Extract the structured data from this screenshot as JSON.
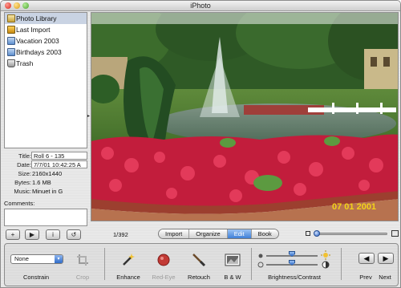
{
  "window": {
    "title": "iPhoto"
  },
  "source_list": {
    "items": [
      {
        "label": "Photo Library",
        "icon": "photo-library-icon",
        "selected": true
      },
      {
        "label": "Last Import",
        "icon": "last-import-icon",
        "selected": false
      },
      {
        "label": "Vacation 2003",
        "icon": "album-icon",
        "selected": false
      },
      {
        "label": "Birthdays 2003",
        "icon": "album-icon",
        "selected": false
      },
      {
        "label": "Trash",
        "icon": "trash-icon",
        "selected": false
      }
    ]
  },
  "info": {
    "title_label": "Title:",
    "title_value": "Roll 6 - 135",
    "date_label": "Date:",
    "date_value": "7/7/01  10:42:25 A",
    "size_label": "Size:",
    "size_value": "2160x1440",
    "bytes_label": "Bytes:",
    "bytes_value": "1.6 MB",
    "music_label": "Music:",
    "music_value": "Minuet in G",
    "comments_label": "Comments:"
  },
  "photo": {
    "date_stamp": "07 01 2001",
    "description_icon": "garden-fountain-photo"
  },
  "toolbar": {
    "add_label": "+",
    "play_label": "▶",
    "info_label": "i",
    "rotate_label": "↺",
    "photo_count": "1/392",
    "modes": [
      "Import",
      "Organize",
      "Edit",
      "Book"
    ],
    "active_mode": "Edit",
    "zoom_level": 0.05
  },
  "edit": {
    "constrain_value": "None",
    "constrain_label": "Constrain",
    "crop_label": "Crop",
    "enhance_label": "Enhance",
    "red_eye_label": "Red-Eye",
    "retouch_label": "Retouch",
    "bw_label": "B & W",
    "brightness_contrast_label": "Brightness/Contrast",
    "brightness_level": 0.5,
    "contrast_level": 0.5,
    "prev_label": "Prev",
    "next_label": "Next"
  },
  "colors": {
    "selection": "#c9d3e3",
    "accent_blue": "#3e7fd8",
    "date_stamp": "#f2d21a"
  }
}
